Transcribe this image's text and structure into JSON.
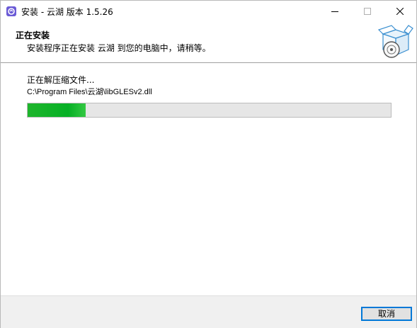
{
  "window": {
    "title": "安装 - 云湖 版本 1.5.26",
    "controls": {
      "minimize": "minimize-icon",
      "maximize": "maximize-icon",
      "close": "close-icon"
    }
  },
  "header": {
    "title": "正在安装",
    "subtitle": "安装程序正在安装 云湖 到您的电脑中，请稍等。",
    "graphic": "install-box-icon"
  },
  "body": {
    "status": "正在解压缩文件...",
    "current_file": "C:\\Program Files\\云湖\\libGLESv2.dll",
    "progress": 0.16
  },
  "footer": {
    "cancel_label": "取消"
  },
  "colors": {
    "accent": "#0078d7",
    "progress_green": "#06b025",
    "app_icon": "#6b5bd6"
  }
}
